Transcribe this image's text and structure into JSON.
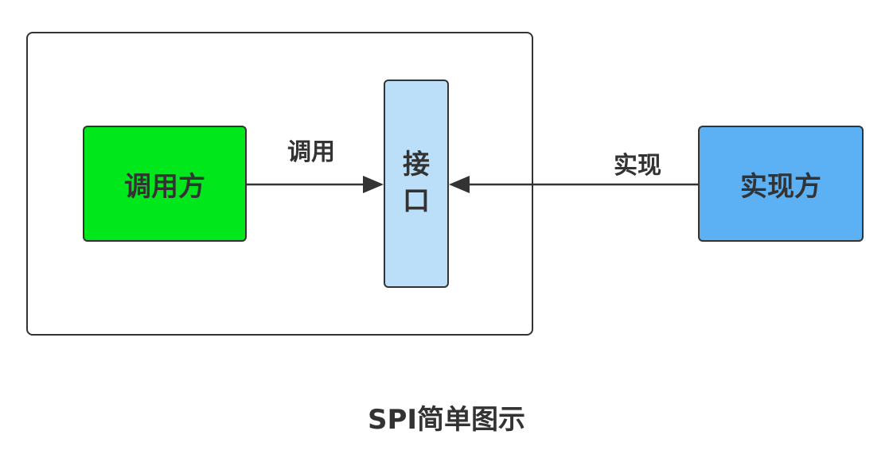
{
  "diagram": {
    "nodes": {
      "caller": "调用方",
      "interface": "接口",
      "implementer": "实现方"
    },
    "edges": {
      "call_label": "调用",
      "implement_label": "实现"
    },
    "caption": "SPI简单图示",
    "colors": {
      "caller_fill": "#00e81c",
      "interface_fill": "#bcdff9",
      "implementer_fill": "#5cb1f4",
      "stroke": "#333333"
    }
  }
}
